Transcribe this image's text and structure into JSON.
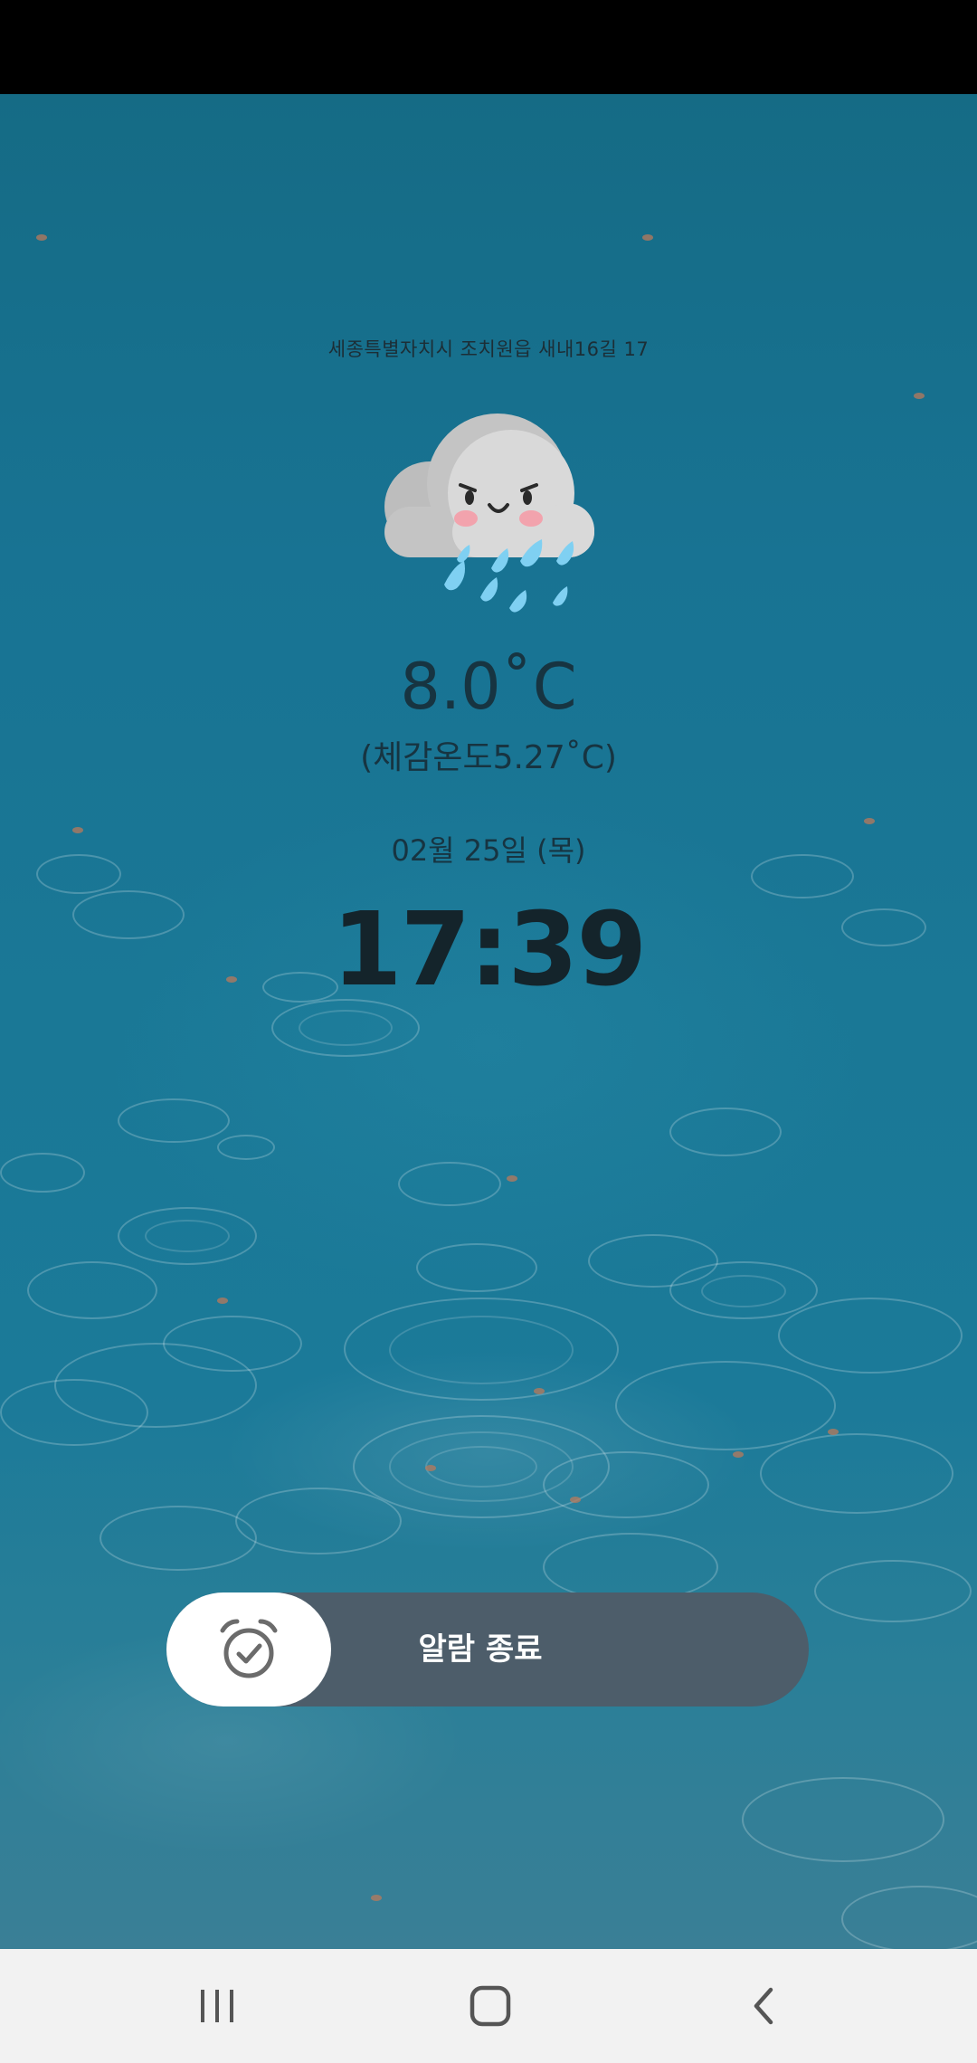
{
  "weather": {
    "address": "세종특별자치시 조치원읍 새내16길 17",
    "icon": "rain-cloud-icon",
    "temperature": "8.0˚C",
    "feels_like": "(체감온도5.27˚C)"
  },
  "date": "02월 25일 (목)",
  "time": "17:39",
  "alarm": {
    "icon": "alarm-clock-icon",
    "dismiss_label": "알람 종료"
  },
  "navigation": {
    "recents_icon": "recents-icon",
    "home_icon": "home-icon",
    "back_icon": "back-icon"
  },
  "colors": {
    "wallpaper": "#1a7896",
    "text_dark": "#173441",
    "slider_bg": "#4d5d6a",
    "cloud": "#d6d6d6",
    "raindrop": "#7fd0f2"
  }
}
